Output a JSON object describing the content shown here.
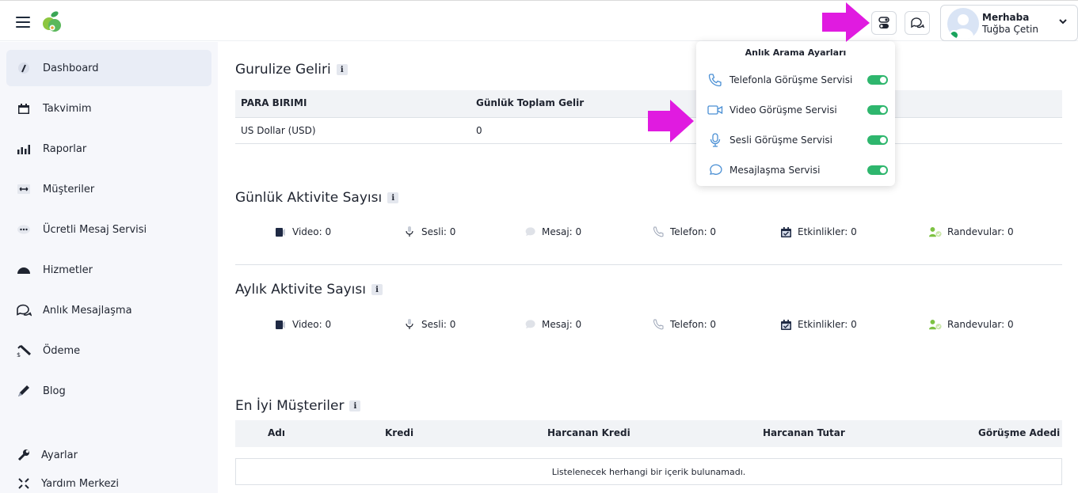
{
  "header": {
    "greeting": "Merhaba",
    "user_name": "Tuğba Çetin"
  },
  "sidebar": {
    "items": [
      {
        "label": "Dashboard",
        "icon": "dashboard-gauge-icon",
        "active": true
      },
      {
        "label": "Takvimim",
        "icon": "calendar-icon"
      },
      {
        "label": "Raporlar",
        "icon": "bar-chart-icon"
      },
      {
        "label": "Müşteriler",
        "icon": "customers-icon"
      },
      {
        "label": "Ücretli Mesaj Servisi",
        "icon": "ellipsis-chat-icon"
      },
      {
        "label": "Hizmetler",
        "icon": "dome-icon"
      },
      {
        "label": "Anlık Mesajlaşma",
        "icon": "chat-bubbles-icon"
      },
      {
        "label": "Ödeme",
        "icon": "payment-icon"
      },
      {
        "label": "Blog",
        "icon": "pencil-icon"
      },
      {
        "label": "Ayarlar",
        "icon": "wrench-icon"
      },
      {
        "label": "Yardım Merkezi",
        "icon": "help-arrows-icon"
      }
    ]
  },
  "revenue": {
    "title": "Gurulize Geliri",
    "columns": [
      "PARA BIRIMI",
      "Günlük Toplam Gelir"
    ],
    "rows": [
      [
        "US Dollar (USD)",
        "0"
      ]
    ]
  },
  "daily": {
    "title": "Günlük Aktivite Sayısı",
    "items": [
      {
        "label": "Video: 0",
        "icon": "video-icon"
      },
      {
        "label": "Sesli: 0",
        "icon": "microphone-icon"
      },
      {
        "label": "Mesaj: 0",
        "icon": "message-icon"
      },
      {
        "label": "Telefon: 0",
        "icon": "phone-icon"
      },
      {
        "label": "Etkinlikler: 0",
        "icon": "calendar-check-icon"
      },
      {
        "label": "Randevular: 0",
        "icon": "user-check-icon"
      }
    ]
  },
  "monthly": {
    "title": "Aylık Aktivite Sayısı",
    "items": [
      {
        "label": "Video: 0",
        "icon": "video-icon"
      },
      {
        "label": "Sesli: 0",
        "icon": "microphone-icon"
      },
      {
        "label": "Mesaj: 0",
        "icon": "message-icon"
      },
      {
        "label": "Telefon: 0",
        "icon": "phone-icon"
      },
      {
        "label": "Etkinlikler: 0",
        "icon": "calendar-check-icon"
      },
      {
        "label": "Randevular: 0",
        "icon": "user-check-icon"
      }
    ]
  },
  "customers": {
    "title": "En İyi Müşteriler",
    "columns": [
      "Adı",
      "Kredi",
      "Harcanan Kredi",
      "Harcanan Tutar",
      "Görüşme Adedi"
    ],
    "empty_text": "Listelenecek herhangi bir içerik bulunamadı."
  },
  "popup": {
    "title": "Anlık Arama Ayarları",
    "items": [
      {
        "label": "Telefonla Görüşme Servisi",
        "icon": "phone-outline-icon",
        "enabled": true
      },
      {
        "label": "Video Görüşme Servisi",
        "icon": "video-outline-icon",
        "enabled": true
      },
      {
        "label": "Sesli Görüşme Servisi",
        "icon": "microphone-outline-icon",
        "enabled": true
      },
      {
        "label": "Mesajlaşma Servisi",
        "icon": "chat-outline-icon",
        "enabled": true
      }
    ]
  },
  "colors": {
    "accent_green": "#2eb66d",
    "annotation_magenta": "#e01be0",
    "sidebar_bg": "#f6f7fb",
    "active_item_bg": "#e9edf6"
  }
}
